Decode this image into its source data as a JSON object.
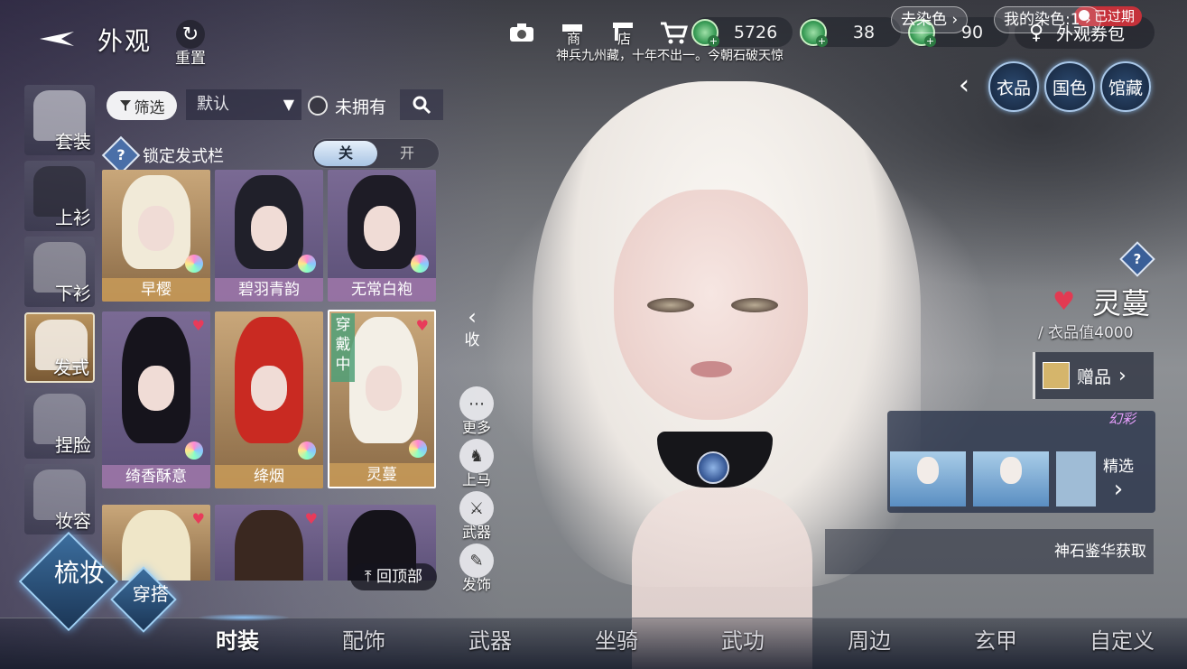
{
  "header": {
    "title": "外观",
    "reset_label": "重置",
    "shop_label": "商",
    "store_label": "店",
    "marquee": "神兵九州藏，十年不出一。今朝石破天惊"
  },
  "currencies": [
    {
      "icon": "jade-coin-icon",
      "amount": "5726"
    },
    {
      "icon": "jade-coin-icon",
      "amount": "38"
    },
    {
      "icon": "jade-coin-icon",
      "amount": "90"
    }
  ],
  "voucher": {
    "label": "外观券包",
    "badge": "已过期"
  },
  "categories": [
    "衣品",
    "国色",
    "馆藏"
  ],
  "left_tabs": [
    "套装",
    "上衫",
    "下衫",
    "发式",
    "捏脸",
    "妆容"
  ],
  "filters": {
    "filter_label": "筛选",
    "sort_value": "默认",
    "unowned_label": "未拥有",
    "lock_label": "锁定发式栏",
    "toggle_off": "关",
    "toggle_on": "开"
  },
  "hairstyles": [
    {
      "name": "早樱",
      "style": "gold"
    },
    {
      "name": "碧羽青韵",
      "style": "lilac"
    },
    {
      "name": "无常白袍",
      "style": "lilac"
    },
    {
      "name": "绮香酥意",
      "style": "lilac"
    },
    {
      "name": "绛烟",
      "style": "gold"
    },
    {
      "name": "灵蔓",
      "style": "gold",
      "wearing": "穿戴中"
    }
  ],
  "back_to_top": "回顶部",
  "side_actions": {
    "collapse": "收",
    "more": "更多",
    "mount": "上马",
    "weapon": "武器",
    "hair_ornament": "发饰"
  },
  "item": {
    "name": "灵蔓",
    "value_text": "衣品值4000",
    "gift_label": "赠品",
    "dye_button": "去染色",
    "my_dye_button": "我的染色:1",
    "dye_tag": "幻彩",
    "pick_label": "精选",
    "source_text": "神石鉴华获取"
  },
  "bottom_nav": [
    "时装",
    "配饰",
    "武器",
    "坐骑",
    "武功",
    "周边",
    "玄甲",
    "自定义"
  ],
  "mode_buttons": {
    "makeup": "梳妆",
    "outfit": "穿搭"
  },
  "colors": {
    "heart": "#e23a52",
    "expired": "#c5313a",
    "accent_blue": "#9fd0f4"
  }
}
